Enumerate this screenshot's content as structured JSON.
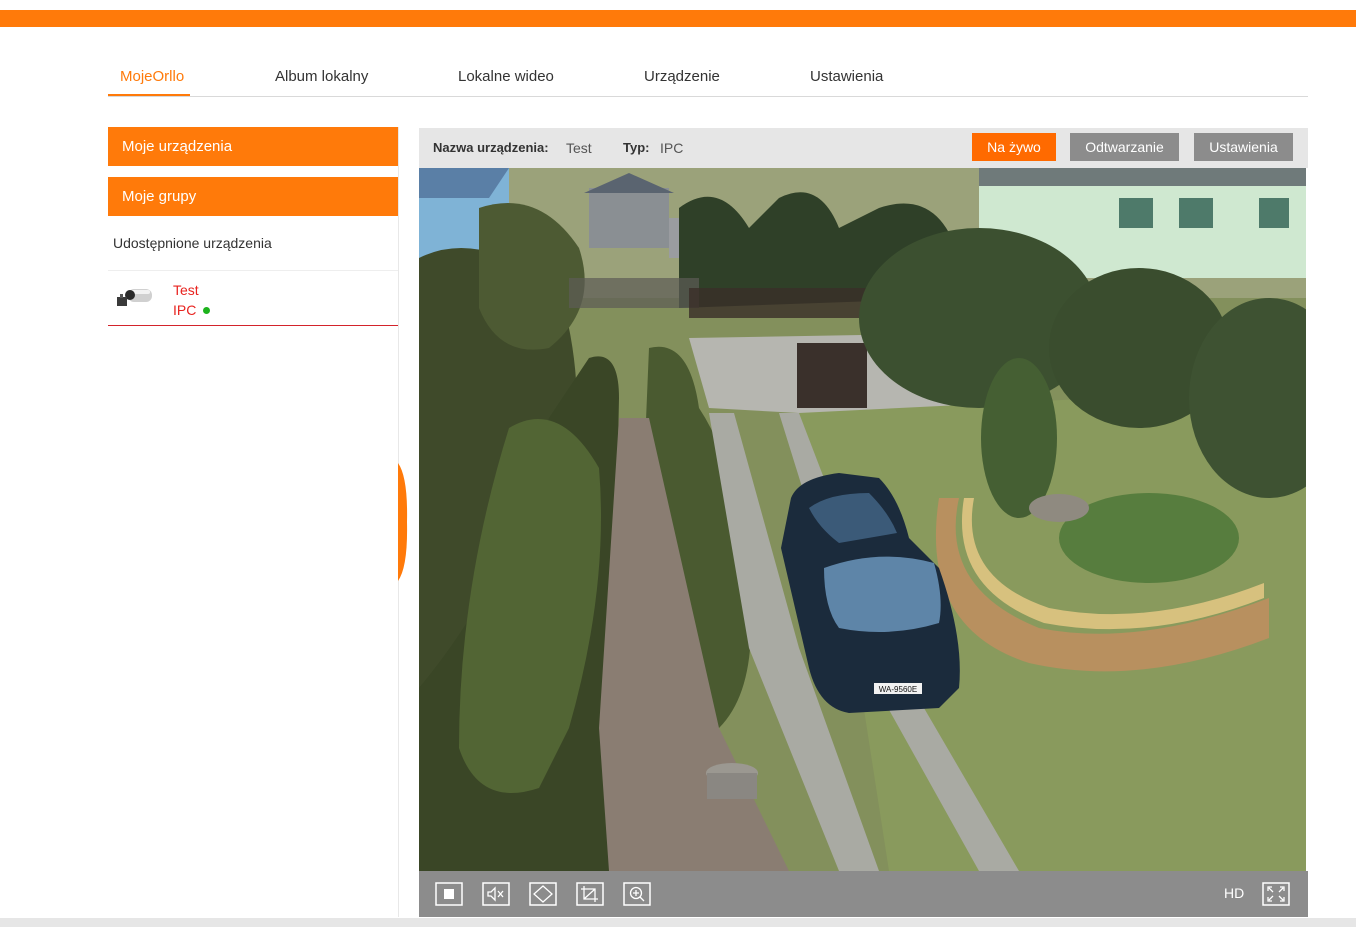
{
  "nav": {
    "tabs": [
      "MojeOrllo",
      "Album lokalny",
      "Lokalne wideo",
      "Urządzenie",
      "Ustawienia"
    ],
    "active": "MojeOrllo"
  },
  "sidebar": {
    "my_devices": "Moje urządzenia",
    "my_groups": "Moje grupy",
    "shared": "Udostępnione urządzenia",
    "device": {
      "name": "Test",
      "type": "IPC",
      "status_color": "#1db31d"
    }
  },
  "panel": {
    "name_label": "Nazwa urządzenia",
    "name_value": "Test",
    "type_label": "Typ",
    "type_value": "IPC",
    "buttons": [
      "Na żywo",
      "Odtwarzanie",
      "Ustawienia"
    ]
  },
  "plate": "WA-9560E",
  "controls": {
    "icons": [
      "stop-icon",
      "mute-icon",
      "ptz-icon",
      "crop-icon",
      "zoom-icon"
    ],
    "quality": "HD",
    "fullscreen_icon": "fullscreen-icon"
  },
  "colors": {
    "accent": "#ff7a0a",
    "grey_btn": "#8c8c8c",
    "device_red": "#e8231f"
  }
}
